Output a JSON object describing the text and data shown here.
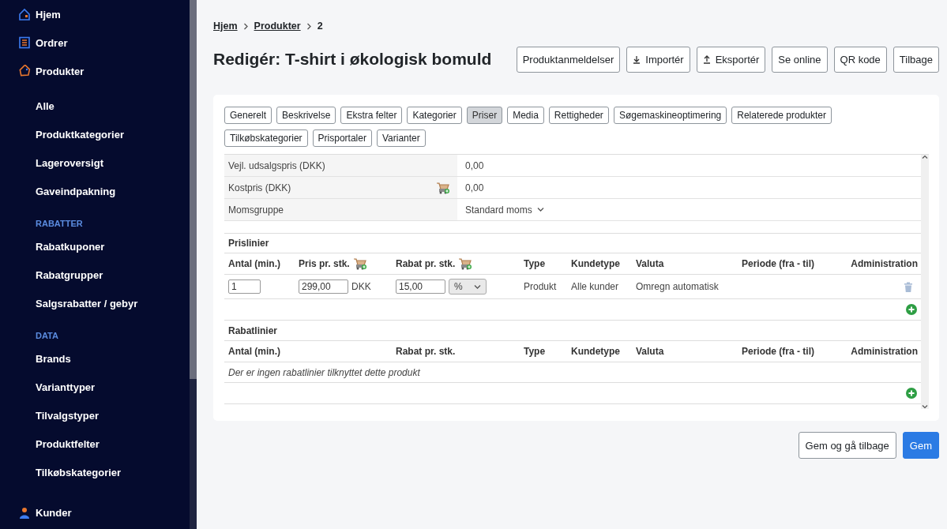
{
  "sidebar": {
    "items": [
      {
        "label": "Hjem",
        "kind": "main"
      },
      {
        "label": "Ordrer",
        "kind": "main"
      },
      {
        "label": "Produkter",
        "kind": "main"
      },
      {
        "label": "Alle",
        "kind": "sub"
      },
      {
        "label": "Produktkategorier",
        "kind": "sub"
      },
      {
        "label": "Lageroversigt",
        "kind": "sub"
      },
      {
        "label": "Gaveindpakning",
        "kind": "sub"
      },
      {
        "label": "RABATTER",
        "kind": "section"
      },
      {
        "label": "Rabatkuponer",
        "kind": "sub"
      },
      {
        "label": "Rabatgrupper",
        "kind": "sub"
      },
      {
        "label": "Salgsrabatter / gebyr",
        "kind": "sub"
      },
      {
        "label": "DATA",
        "kind": "section"
      },
      {
        "label": "Brands",
        "kind": "sub"
      },
      {
        "label": "Varianttyper",
        "kind": "sub"
      },
      {
        "label": "Tilvalgstyper",
        "kind": "sub"
      },
      {
        "label": "Produktfelter",
        "kind": "sub"
      },
      {
        "label": "Tilkøbskategorier",
        "kind": "sub"
      },
      {
        "label": "Kunder",
        "kind": "main"
      }
    ]
  },
  "breadcrumb": [
    {
      "label": "Hjem",
      "kind": "link"
    },
    {
      "label": "Produkter",
      "kind": "link"
    },
    {
      "label": "2",
      "kind": "current"
    }
  ],
  "title": "Redigér: T-shirt i økologisk bomuld",
  "header_buttons": [
    {
      "label": "Produktanmeldelser",
      "kind": "plain"
    },
    {
      "label": "Importér",
      "kind": "import"
    },
    {
      "label": "Eksportér",
      "kind": "export"
    },
    {
      "label": "Se online",
      "kind": "plain"
    },
    {
      "label": "QR kode",
      "kind": "plain"
    },
    {
      "label": "Tilbage",
      "kind": "plain"
    }
  ],
  "tabs": [
    {
      "label": "Generelt",
      "selected": false
    },
    {
      "label": "Beskrivelse",
      "selected": false
    },
    {
      "label": "Ekstra felter",
      "selected": false
    },
    {
      "label": "Kategorier",
      "selected": false
    },
    {
      "label": "Priser",
      "selected": true
    },
    {
      "label": "Media",
      "selected": false
    },
    {
      "label": "Rettigheder",
      "selected": false
    },
    {
      "label": "Søgemaskineoptimering",
      "selected": false
    },
    {
      "label": "Relaterede produkter",
      "selected": false
    },
    {
      "label": "Tilkøbskategorier",
      "selected": false
    },
    {
      "label": "Prisportaler",
      "selected": false
    },
    {
      "label": "Varianter",
      "selected": false
    }
  ],
  "fields": [
    {
      "label": "Vejl. udsalgspris (DKK)",
      "value": "0,00",
      "kind": "text"
    },
    {
      "label": "Kostpris (DKK)",
      "value": "0,00",
      "kind": "cart"
    },
    {
      "label": "Momsgruppe",
      "value": "Standard moms",
      "kind": "select"
    }
  ],
  "prislinier": {
    "title": "Prislinier",
    "columns": [
      {
        "label": "Antal (min.)",
        "kind": "plain"
      },
      {
        "label": "Pris pr. stk.",
        "kind": "cart"
      },
      {
        "label": "Rabat pr. stk.",
        "kind": "cart"
      },
      {
        "label": "Type",
        "kind": "plain"
      },
      {
        "label": "Kundetype",
        "kind": "plain"
      },
      {
        "label": "Valuta",
        "kind": "plain"
      },
      {
        "label": "Periode (fra - til)",
        "kind": "plain"
      },
      {
        "label": "Administration",
        "kind": "plain"
      }
    ],
    "rows": [
      {
        "antal": "1",
        "pris": "299,00",
        "currency": "DKK",
        "rabat": "15,00",
        "rabat_unit": "%",
        "type": "Produkt",
        "kundetype": "Alle kunder",
        "valuta": "Omregn automatisk"
      }
    ]
  },
  "rabatlinier": {
    "title": "Rabatlinier",
    "columns": [
      {
        "label": "Antal (min.)",
        "kind": "plain"
      },
      {
        "label": "Rabat pr. stk.",
        "kind": "plain"
      },
      {
        "label": "Type",
        "kind": "plain"
      },
      {
        "label": "Kundetype",
        "kind": "plain"
      },
      {
        "label": "Valuta",
        "kind": "plain"
      },
      {
        "label": "Periode (fra - til)",
        "kind": "plain"
      },
      {
        "label": "Administration",
        "kind": "plain"
      }
    ],
    "empty_message": "Der er ingen rabatlinier tilknyttet dette produkt"
  },
  "footer_buttons": [
    {
      "label": "Gem og gå tilbage",
      "kind": "secondary"
    },
    {
      "label": "Gem",
      "kind": "primary"
    }
  ]
}
